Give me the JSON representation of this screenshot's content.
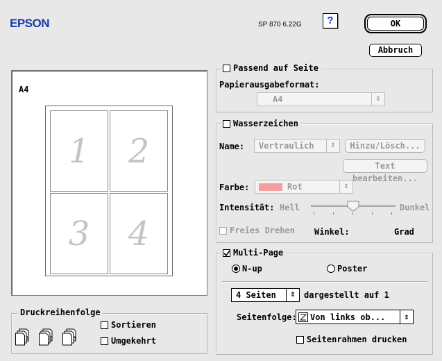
{
  "header": {
    "logo": "EPSON",
    "version": "SP 870 6.22G",
    "help_label": "?"
  },
  "buttons": {
    "ok": "OK",
    "cancel": "Abbruch"
  },
  "preview": {
    "paper_label": "A4",
    "pages": [
      "1",
      "2",
      "3",
      "4"
    ]
  },
  "fit_to_page": {
    "label": "Passend auf Seite",
    "checked": false,
    "paper_format_label": "Papierausgabeformat:",
    "paper_format_value": "A4"
  },
  "watermark": {
    "label": "Wasserzeichen",
    "checked": false,
    "name_label": "Name:",
    "name_value": "Vertraulich",
    "add_delete_label": "Hinzu/Lösch...",
    "edit_text_label": "Text bearbeiten...",
    "color_label": "Farbe:",
    "color_value": "Rot",
    "color_swatch": "#f4a0a0",
    "intensity_label": "Intensität:",
    "intensity_low": "Hell",
    "intensity_high": "Dunkel",
    "intensity_level": 0.5,
    "free_rotate_label": "Freies Drehen",
    "angle_label": "Winkel:",
    "angle_unit": "Grad"
  },
  "multi_page": {
    "label": "Multi-Page",
    "checked": true,
    "nup_label": "N-up",
    "poster_label": "Poster",
    "selected": "N-up",
    "pages_value": "4 Seiten",
    "pages_suffix": "dargestellt auf 1",
    "order_label": "Seitenfolge:",
    "order_value": "Von links ob...",
    "border_label": "Seitenrahmen drucken"
  },
  "print_order": {
    "label": "Druckreihenfolge",
    "collate_label": "Sortieren",
    "reverse_label": "Umgekehrt"
  }
}
